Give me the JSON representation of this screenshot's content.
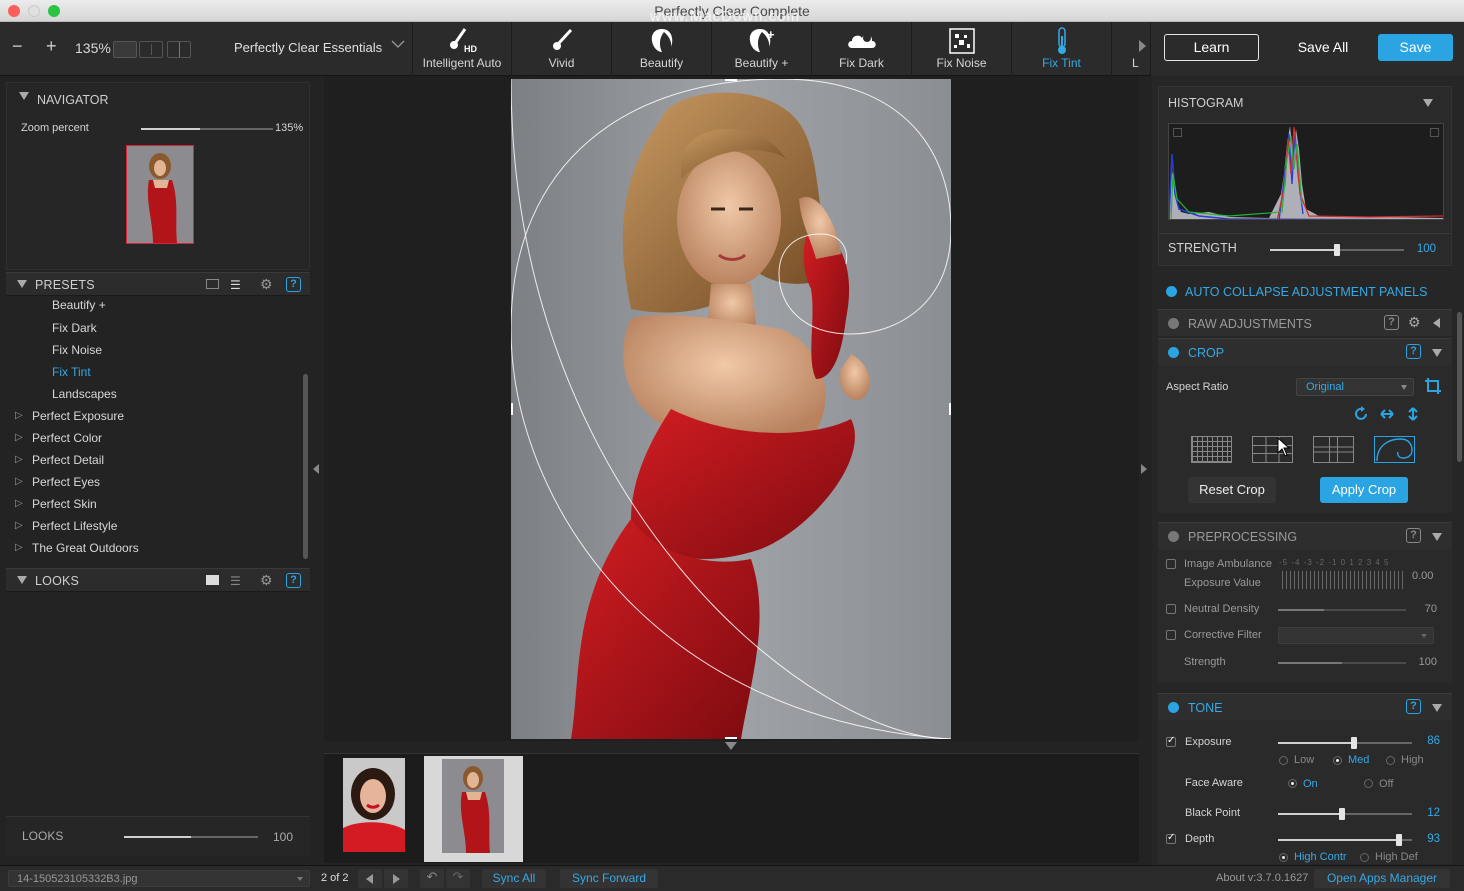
{
  "window": {
    "title": "Perfectly Clear Complete",
    "watermark": "www.MacDown.com"
  },
  "toolbar": {
    "zoom_out": "−",
    "zoom_in": "+",
    "zoom": "135%",
    "preset_name": "Perfectly Clear Essentials",
    "tools": [
      {
        "label": "Intelligent Auto",
        "icon": "brush-hd-icon"
      },
      {
        "label": "Vivid",
        "icon": "brush-icon"
      },
      {
        "label": "Beautify",
        "icon": "face-icon"
      },
      {
        "label": "Beautify +",
        "icon": "face-plus-icon"
      },
      {
        "label": "Fix Dark",
        "icon": "cloud-icon"
      },
      {
        "label": "Fix Noise",
        "icon": "noise-icon"
      },
      {
        "label": "Fix Tint",
        "icon": "thermometer-icon"
      }
    ],
    "overflow_label": "L",
    "learn": "Learn",
    "save_all": "Save All",
    "save": "Save"
  },
  "navigator": {
    "title": "NAVIGATOR",
    "zoom_label": "Zoom percent",
    "zoom_value": "135%",
    "zoom_level": 0.45
  },
  "presets": {
    "title": "PRESETS",
    "children": [
      "Beautify +",
      "Fix Dark",
      "Fix Noise",
      "Fix Tint",
      "Landscapes"
    ],
    "selected": "Fix Tint",
    "groups": [
      "Perfect Exposure",
      "Perfect Color",
      "Perfect Detail",
      "Perfect Eyes",
      "Perfect Skin",
      "Perfect Lifestyle",
      "The Great Outdoors"
    ]
  },
  "looks": {
    "title": "LOOKS",
    "footer_label": "LOOKS",
    "value": "100",
    "level": 0.5
  },
  "histogram": {
    "title": "HISTOGRAM",
    "strength_label": "STRENGTH",
    "strength_value": "100",
    "strength_level": 0.5
  },
  "auto_collapse": "AUTO COLLAPSE ADJUSTMENT PANELS",
  "raw": {
    "title": "RAW ADJUSTMENTS"
  },
  "crop": {
    "title": "CROP",
    "aspect_label": "Aspect Ratio",
    "aspect_value": "Original",
    "reset": "Reset Crop",
    "apply": "Apply Crop"
  },
  "preprocessing": {
    "title": "PREPROCESSING",
    "ambulance_label": "Image Ambulance",
    "exposure_label": "Exposure Value",
    "exposure_scale": "-5 -4 -3 -2 -1 0 1 2 3 4 5",
    "exposure_value": "0.00",
    "neutral_label": "Neutral Density",
    "neutral_value": "70",
    "neutral_level": 0.36,
    "corrective_label": "Corrective Filter",
    "strength_label": "Strength",
    "strength_value": "100",
    "strength_level": 0.5
  },
  "tone": {
    "title": "TONE",
    "exposure_label": "Exposure",
    "exposure_value": "86",
    "exposure_level": 0.57,
    "low": "Low",
    "med": "Med",
    "high": "High",
    "face_aware_label": "Face Aware",
    "on": "On",
    "off": "Off",
    "black_label": "Black Point",
    "black_value": "12",
    "black_level": 0.48,
    "depth_label": "Depth",
    "depth_value": "93",
    "depth_level": 0.9,
    "high_contr": "High Contr",
    "high_def": "High Def"
  },
  "status": {
    "filename": "14-150523105332B3.jpg",
    "page": "2 of 2",
    "sync_all": "Sync All",
    "sync_forward": "Sync Forward",
    "about": "About v:3.7.0.1627",
    "open_apps": "Open Apps Manager"
  },
  "colors": {
    "accent": "#2aa4e2",
    "dress": "#b3141a",
    "background": "#232323"
  }
}
